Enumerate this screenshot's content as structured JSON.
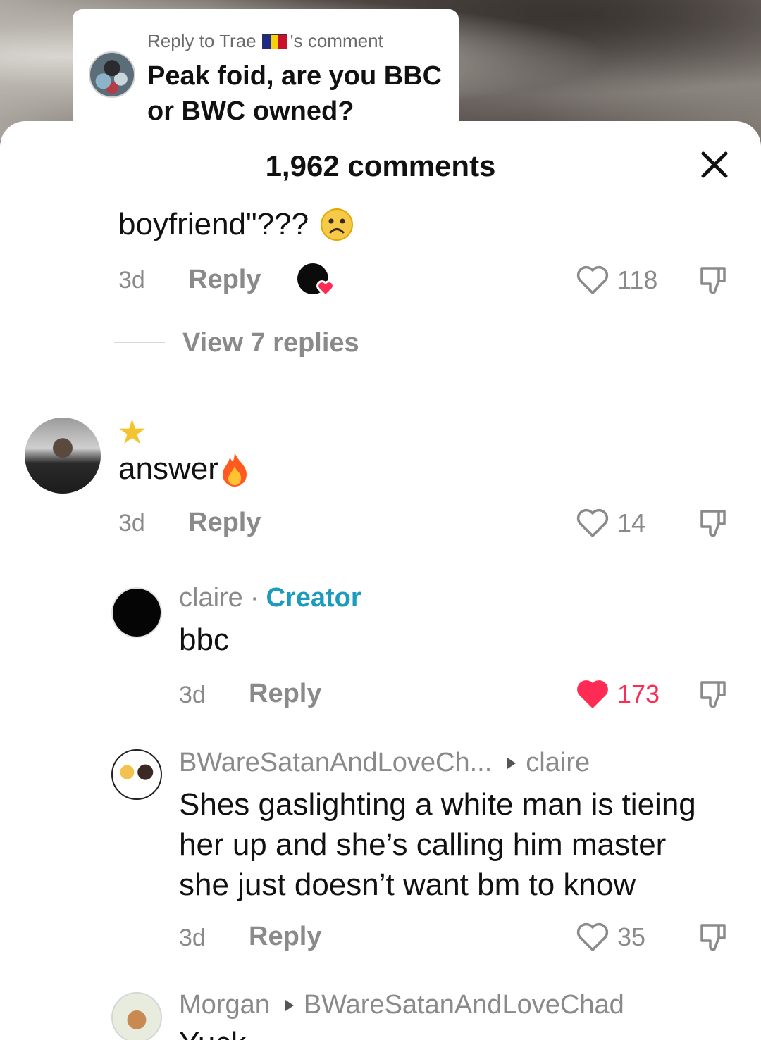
{
  "reply_banner": {
    "prefix": "Reply to Trae",
    "suffix": "'s comment",
    "flag_colors": [
      "#1d2a8c",
      "#f5d20a",
      "#c8102e"
    ],
    "quote": "Peak foid, are you BBC or BWC owned?"
  },
  "sheet": {
    "title": "1,962 comments",
    "close_icon": "close-icon"
  },
  "colors": {
    "accent_like": "#fe2c55",
    "creator": "#1d9bbf",
    "meta": "#8a8a8a"
  },
  "comments": [
    {
      "text": "boyfriend\"???",
      "emoji": "😟",
      "time": "3d",
      "reply_label": "Reply",
      "likes": "118",
      "liked": false,
      "view_replies": "View 7 replies"
    },
    {
      "badge": "★",
      "text": "answer",
      "emoji": "🔥",
      "time": "3d",
      "reply_label": "Reply",
      "likes": "14",
      "liked": false
    },
    {
      "user": "claire",
      "separator": "·",
      "tag": "Creator",
      "text": "bbc",
      "time": "3d",
      "reply_label": "Reply",
      "likes": "173",
      "liked": true
    },
    {
      "user": "BWareSatanAndLoveCh...",
      "reply_to": "claire",
      "text_lines": [
        "Shes gaslighting a white man is tieing",
        "her up and she’s calling him master",
        "she just doesn’t want bm to know"
      ],
      "time": "3d",
      "reply_label": "Reply",
      "likes": "35",
      "liked": false
    },
    {
      "user": "Morgan",
      "reply_to": "BWareSatanAndLoveChad",
      "text": "Yuck"
    }
  ]
}
